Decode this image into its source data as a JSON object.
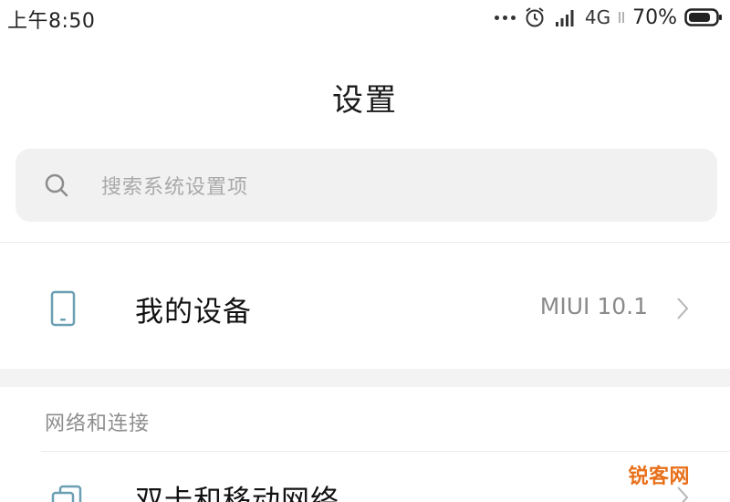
{
  "status_bar": {
    "time": "上午8:50",
    "network": "4G",
    "battery": "70%",
    "icons": [
      "more-dots-icon",
      "alarm-icon",
      "signal-icon",
      "battery-icon"
    ]
  },
  "title": "设置",
  "search": {
    "placeholder": "搜索系统设置项",
    "icon": "search-icon"
  },
  "device": {
    "label": "我的设备",
    "value": "MIUI 10.1",
    "icon": "phone-icon"
  },
  "sections": [
    {
      "label": "网络和连接",
      "items": [
        {
          "label": "双卡和移动网络",
          "icon": "sim-card-icon"
        }
      ]
    }
  ],
  "watermark": "锐客网",
  "colors": {
    "search_bg": "#f1f1f1",
    "section_gap": "#f3f3f3",
    "secondary_text": "#8a8a8a",
    "icon_accent": "#6b9fb3",
    "watermark": "#e8701a"
  }
}
